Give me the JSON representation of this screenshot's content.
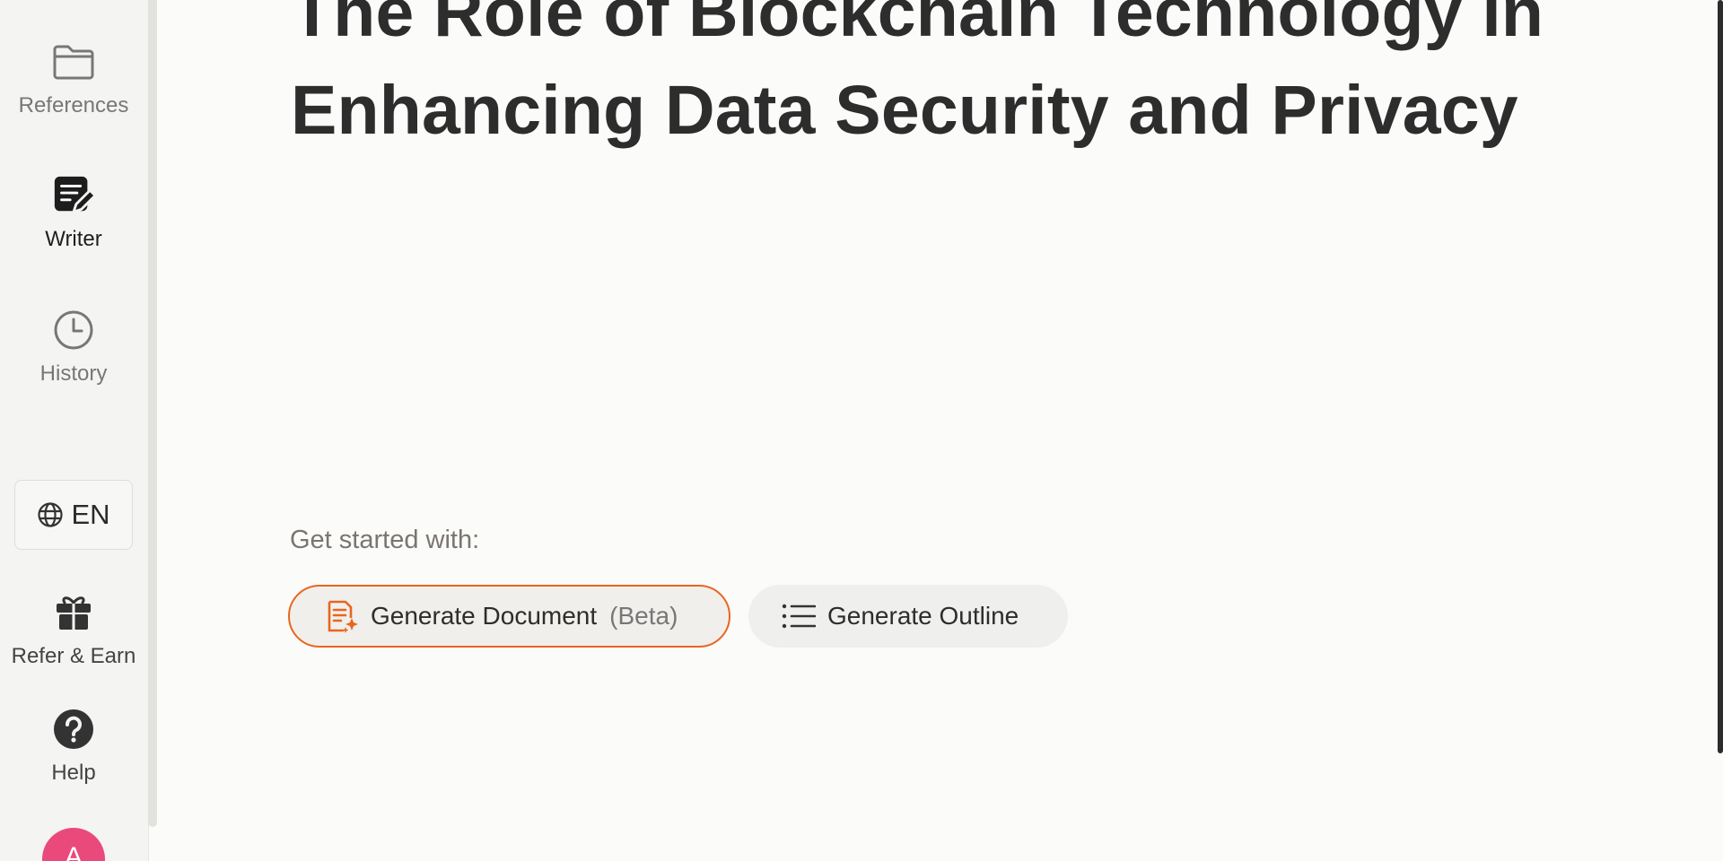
{
  "sidebar": {
    "items": [
      {
        "label": "References",
        "icon": "folder-icon",
        "active": false
      },
      {
        "label": "Writer",
        "icon": "write-icon",
        "active": true
      },
      {
        "label": "History",
        "icon": "clock-icon",
        "active": false
      }
    ],
    "language": {
      "label": "EN",
      "icon": "globe-icon"
    },
    "bottom_items": [
      {
        "label": "Refer & Earn",
        "icon": "gift-icon"
      },
      {
        "label": "Help",
        "icon": "help-icon"
      }
    ],
    "avatar_initial": "A"
  },
  "main": {
    "title": "The Role of Blockchain Technology in Enhancing Data Security and Privacy",
    "get_started_label": "Get started with:",
    "actions": [
      {
        "label": "Generate Document",
        "tag": "(Beta)",
        "icon": "document-sparkle-icon"
      },
      {
        "label": "Generate Outline",
        "icon": "list-icon"
      }
    ]
  },
  "colors": {
    "accent": "#e8661e",
    "avatar": "#e94a7b",
    "background": "#fbfbf9",
    "sidebar": "#f4f4f2"
  }
}
